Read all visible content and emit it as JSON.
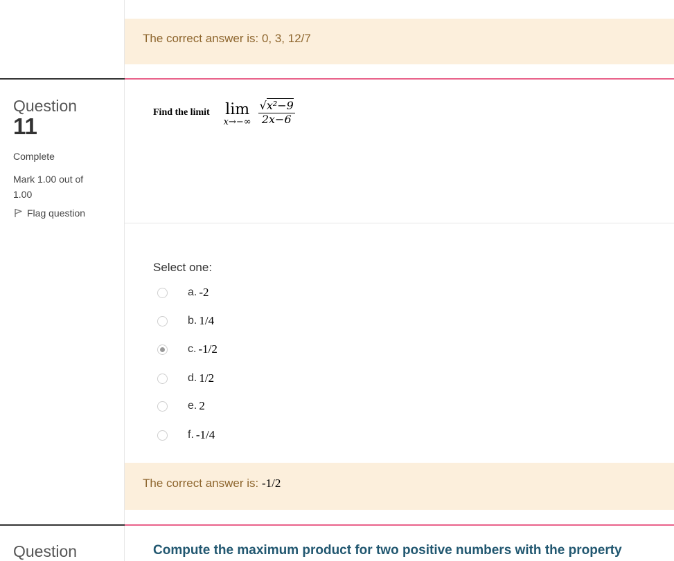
{
  "prev_feedback": {
    "text": "The correct answer is: 0, 3, 12/7"
  },
  "question": {
    "label": "Question",
    "number": "11",
    "status": "Complete",
    "mark": "Mark 1.00 out of 1.00",
    "flag_label": "Flag question",
    "prompt": "Find the limit",
    "math": {
      "lim": "lim",
      "subscript": "x→−∞",
      "numerator": "x²−9",
      "denominator": "2x−6"
    },
    "select_label": "Select one:",
    "options": [
      {
        "letter": "a.",
        "value": "-2",
        "selected": false
      },
      {
        "letter": "b.",
        "value": "1/4",
        "selected": false
      },
      {
        "letter": "c.",
        "value": "-1/2",
        "selected": true
      },
      {
        "letter": "d.",
        "value": "1/2",
        "selected": false
      },
      {
        "letter": "e.",
        "value": "2",
        "selected": false
      },
      {
        "letter": "f.",
        "value": "-1/4",
        "selected": false
      }
    ],
    "feedback_prefix": "The correct answer is: ",
    "feedback_answer": "-1/2"
  },
  "next_question": {
    "label": "Question",
    "text": "Compute the maximum product for two positive numbers with the property"
  },
  "colors": {
    "feedback_bg": "#fcefdc",
    "feedback_text": "#8e662e",
    "accent_line": "#e9618a",
    "next_text": "#215770"
  }
}
